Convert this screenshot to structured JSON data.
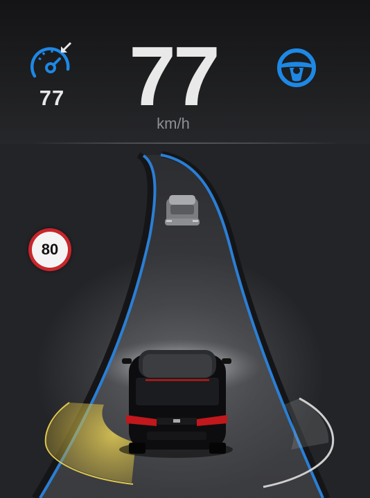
{
  "cruise": {
    "set_speed": "77",
    "icon": "speedometer-icon"
  },
  "speed": {
    "value": "77",
    "unit": "km/h"
  },
  "autosteer": {
    "icon": "steering-wheel-icon",
    "color": "#1e88e5"
  },
  "speed_limit": {
    "value": "80",
    "ring_color": "#c9262b"
  },
  "lane": {
    "line_color": "#2a7fd6"
  },
  "blind_spot": {
    "left_color": "#d8c24a",
    "right_color": "#cfcfcf"
  }
}
